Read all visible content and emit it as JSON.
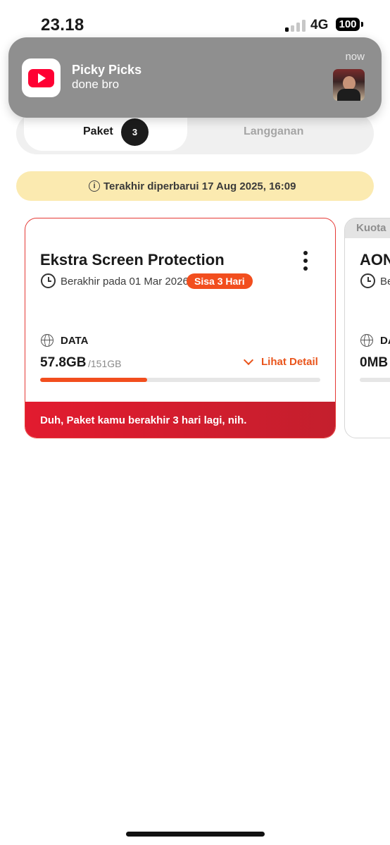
{
  "status_bar": {
    "time": "23.18",
    "network": "4G",
    "battery": "100"
  },
  "notification": {
    "title": "Picky Picks",
    "body": "done bro",
    "time": "now",
    "app_icon": "youtube-icon"
  },
  "tabs": [
    {
      "label": "Paket",
      "count": "3",
      "active": true
    },
    {
      "label": "Langganan",
      "active": false
    }
  ],
  "info_banner": {
    "icon": "info-icon",
    "text": "Terakhir diperbarui 17 Aug 2025, 16:09"
  },
  "packages": [
    {
      "title": "Ekstra Screen Protection",
      "expiry": "Berakhir pada 01 Mar 2026",
      "badge": "Sisa 3 Hari",
      "data_label": "DATA",
      "used": "57.8GB",
      "total": "/151GB",
      "usage_fraction": 0.383,
      "detail_label": "Lihat Detail",
      "warning": "Duh, Paket kamu berakhir 3 hari lagi, nih.",
      "accent_color": "#f24e1e"
    },
    {
      "tag": "Kuota",
      "title": "AON",
      "expiry": "Be",
      "data_label": "DA",
      "used": "0MB"
    }
  ]
}
